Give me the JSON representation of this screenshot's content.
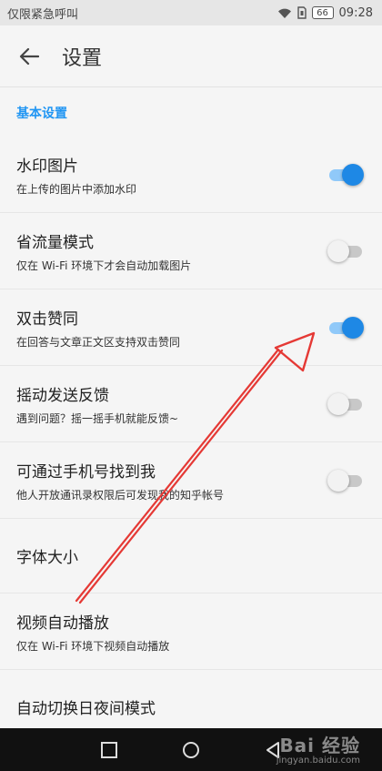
{
  "status_bar": {
    "carrier": "仅限紧急呼叫",
    "battery": "66",
    "time": "09:28",
    "icons": [
      "wifi-icon",
      "sim-icon",
      "battery-icon"
    ]
  },
  "app_bar": {
    "title": "设置",
    "back_icon": "arrow-back-icon"
  },
  "section": {
    "header": "基本设置"
  },
  "settings": [
    {
      "title": "水印图片",
      "subtitle": "在上传的图片中添加水印",
      "toggle": true
    },
    {
      "title": "省流量模式",
      "subtitle": "仅在 Wi-Fi 环境下才会自动加载图片",
      "toggle": false
    },
    {
      "title": "双击赞同",
      "subtitle": "在回答与文章正文区支持双击赞同",
      "toggle": true
    },
    {
      "title": "摇动发送反馈",
      "subtitle": "遇到问题？摇一摇手机就能反馈~",
      "toggle": false
    },
    {
      "title": "可通过手机号找到我",
      "subtitle": "他人开放通讯录权限后可发现我的知乎帐号",
      "toggle": false
    },
    {
      "title": "字体大小"
    },
    {
      "title": "视频自动播放",
      "subtitle": "仅在 Wi-Fi 环境下视频自动播放"
    },
    {
      "title": "自动切换日夜间模式"
    }
  ],
  "nav_bar": {
    "icons": [
      "recent-apps-icon",
      "home-icon",
      "back-icon"
    ]
  },
  "colors": {
    "accent": "#1e88e5",
    "annotation": "#e53935"
  },
  "watermark": {
    "logo": "Bai 经验",
    "site": "jingyan.baidu.com"
  }
}
